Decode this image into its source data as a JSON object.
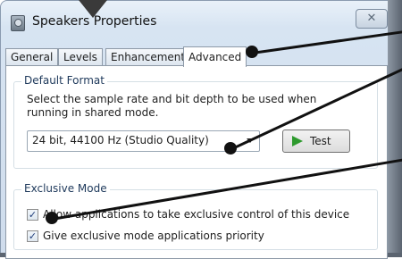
{
  "window": {
    "title": "Speakers Properties",
    "close_glyph": "✕"
  },
  "tabs": [
    {
      "label": "General",
      "active": false
    },
    {
      "label": "Levels",
      "active": false
    },
    {
      "label": "Enhancements",
      "active": false
    },
    {
      "label": "Advanced",
      "active": true
    }
  ],
  "default_format": {
    "group_label": "Default Format",
    "description": "Select the sample rate and bit depth to be used when running in shared mode.",
    "selected_format": "24 bit, 44100 Hz (Studio Quality)",
    "test_label": "Test"
  },
  "exclusive_mode": {
    "group_label": "Exclusive Mode",
    "options": [
      {
        "label": "Allow applications to take exclusive control of this device",
        "checked": true
      },
      {
        "label": "Give exclusive mode applications priority",
        "checked": true
      }
    ]
  },
  "colors": {
    "accent": "#1e395b",
    "play": "#2e9a2e",
    "callout": "#111111"
  },
  "icons": [
    "speaker-app-icon",
    "close-icon",
    "down-arrow-indicator",
    "dropdown-arrow-icon",
    "play-icon",
    "check-icon"
  ]
}
